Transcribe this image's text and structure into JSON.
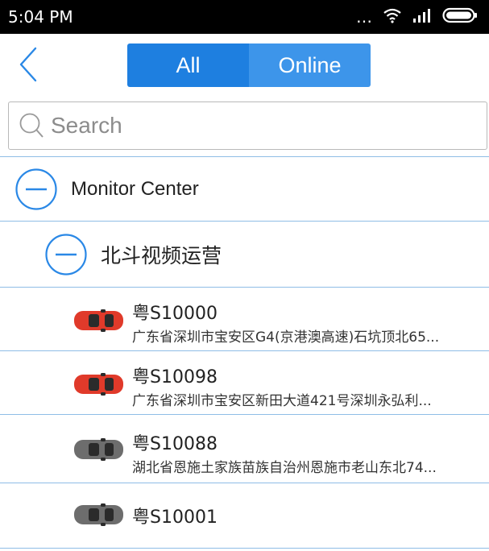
{
  "status_bar": {
    "time": "5:04 PM",
    "icons": [
      "dots-icon",
      "wifi-icon",
      "signal-icon",
      "battery-icon"
    ]
  },
  "nav": {
    "tabs": [
      {
        "label": "All",
        "selected": true
      },
      {
        "label": "Online",
        "selected": false
      }
    ],
    "accent_color": "#1e7fe0"
  },
  "search": {
    "placeholder": "Search"
  },
  "tree": {
    "root_label": "Monitor Center",
    "group_label": "北斗视频运营",
    "vehicles": [
      {
        "plate": "粤S10000",
        "address": "广东省深圳市宝安区G4(京港澳高速)石坑顶北65...",
        "status": "online",
        "color": "#e03a2a"
      },
      {
        "plate": "粤S10098",
        "address": "广东省深圳市宝安区新田大道421号深圳永弘利...",
        "status": "online",
        "color": "#e03a2a"
      },
      {
        "plate": "粤S10088",
        "address": "湖北省恩施土家族苗族自治州恩施市老山东北74...",
        "status": "offline",
        "color": "#6d6d6d"
      },
      {
        "plate": "粤S10001",
        "address": "",
        "status": "offline",
        "color": "#6d6d6d"
      }
    ]
  }
}
